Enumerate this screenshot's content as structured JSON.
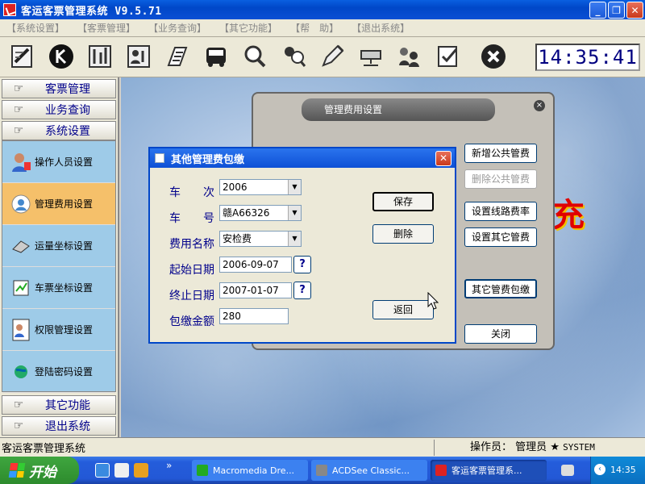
{
  "app": {
    "title": "客运客票管理系统 V9.5.71"
  },
  "menu": [
    "【系统设置】",
    "【客票管理】",
    "【业务查询】",
    "【其它功能】",
    "【帮　助】",
    "【退出系统】"
  ],
  "clock": "14:35:41",
  "sidebar": {
    "hand": "☞",
    "heads_top": [
      "客票管理",
      "业务查询",
      "系统设置"
    ],
    "sub_items": [
      "操作人员设置",
      "管理费用设置",
      "运量坐标设置",
      "车票坐标设置",
      "权限管理设置",
      "登陆密码设置"
    ],
    "heads_bottom": [
      "其它功能",
      "退出系统"
    ]
  },
  "main": {
    "red_char": "充"
  },
  "panel": {
    "title": "管理费用设置",
    "close": "×",
    "buttons": [
      "新增公共管费",
      "删除公共管费",
      "设置线路费率",
      "设置其它管费",
      "其它管费包缴",
      "关闭"
    ]
  },
  "dialog": {
    "title": "其他管理费包缴",
    "close": "✕",
    "labels": [
      "车　　次",
      "车　　号",
      "费用名称",
      "起始日期",
      "终止日期",
      "包缴金额"
    ],
    "values": {
      "train_no": "2006",
      "plate": "赣A66326",
      "fee_name": "安检费",
      "start": "2006-09-07",
      "end": "2007-01-07",
      "amount": "280"
    },
    "q": "?",
    "save": "保存",
    "delete": "删除",
    "back": "返回"
  },
  "status": {
    "left": "客运客票管理系统",
    "operator_label": "操作员：",
    "operator": "管理员",
    "star": "★",
    "system": "SYSTEM"
  },
  "taskbar": {
    "start": "开始",
    "tasks": [
      "Macromedia Dre...",
      "ACDSee Classic...",
      "客运客票管理系..."
    ],
    "time": "14:35",
    "chevron": "»"
  },
  "colors": {
    "titlebar": "#0a5fe0",
    "nav_label": "#00008b",
    "active_sub": "#f5c06a",
    "sub_bg": "#9ecbe8",
    "clock_text": "#000080"
  }
}
